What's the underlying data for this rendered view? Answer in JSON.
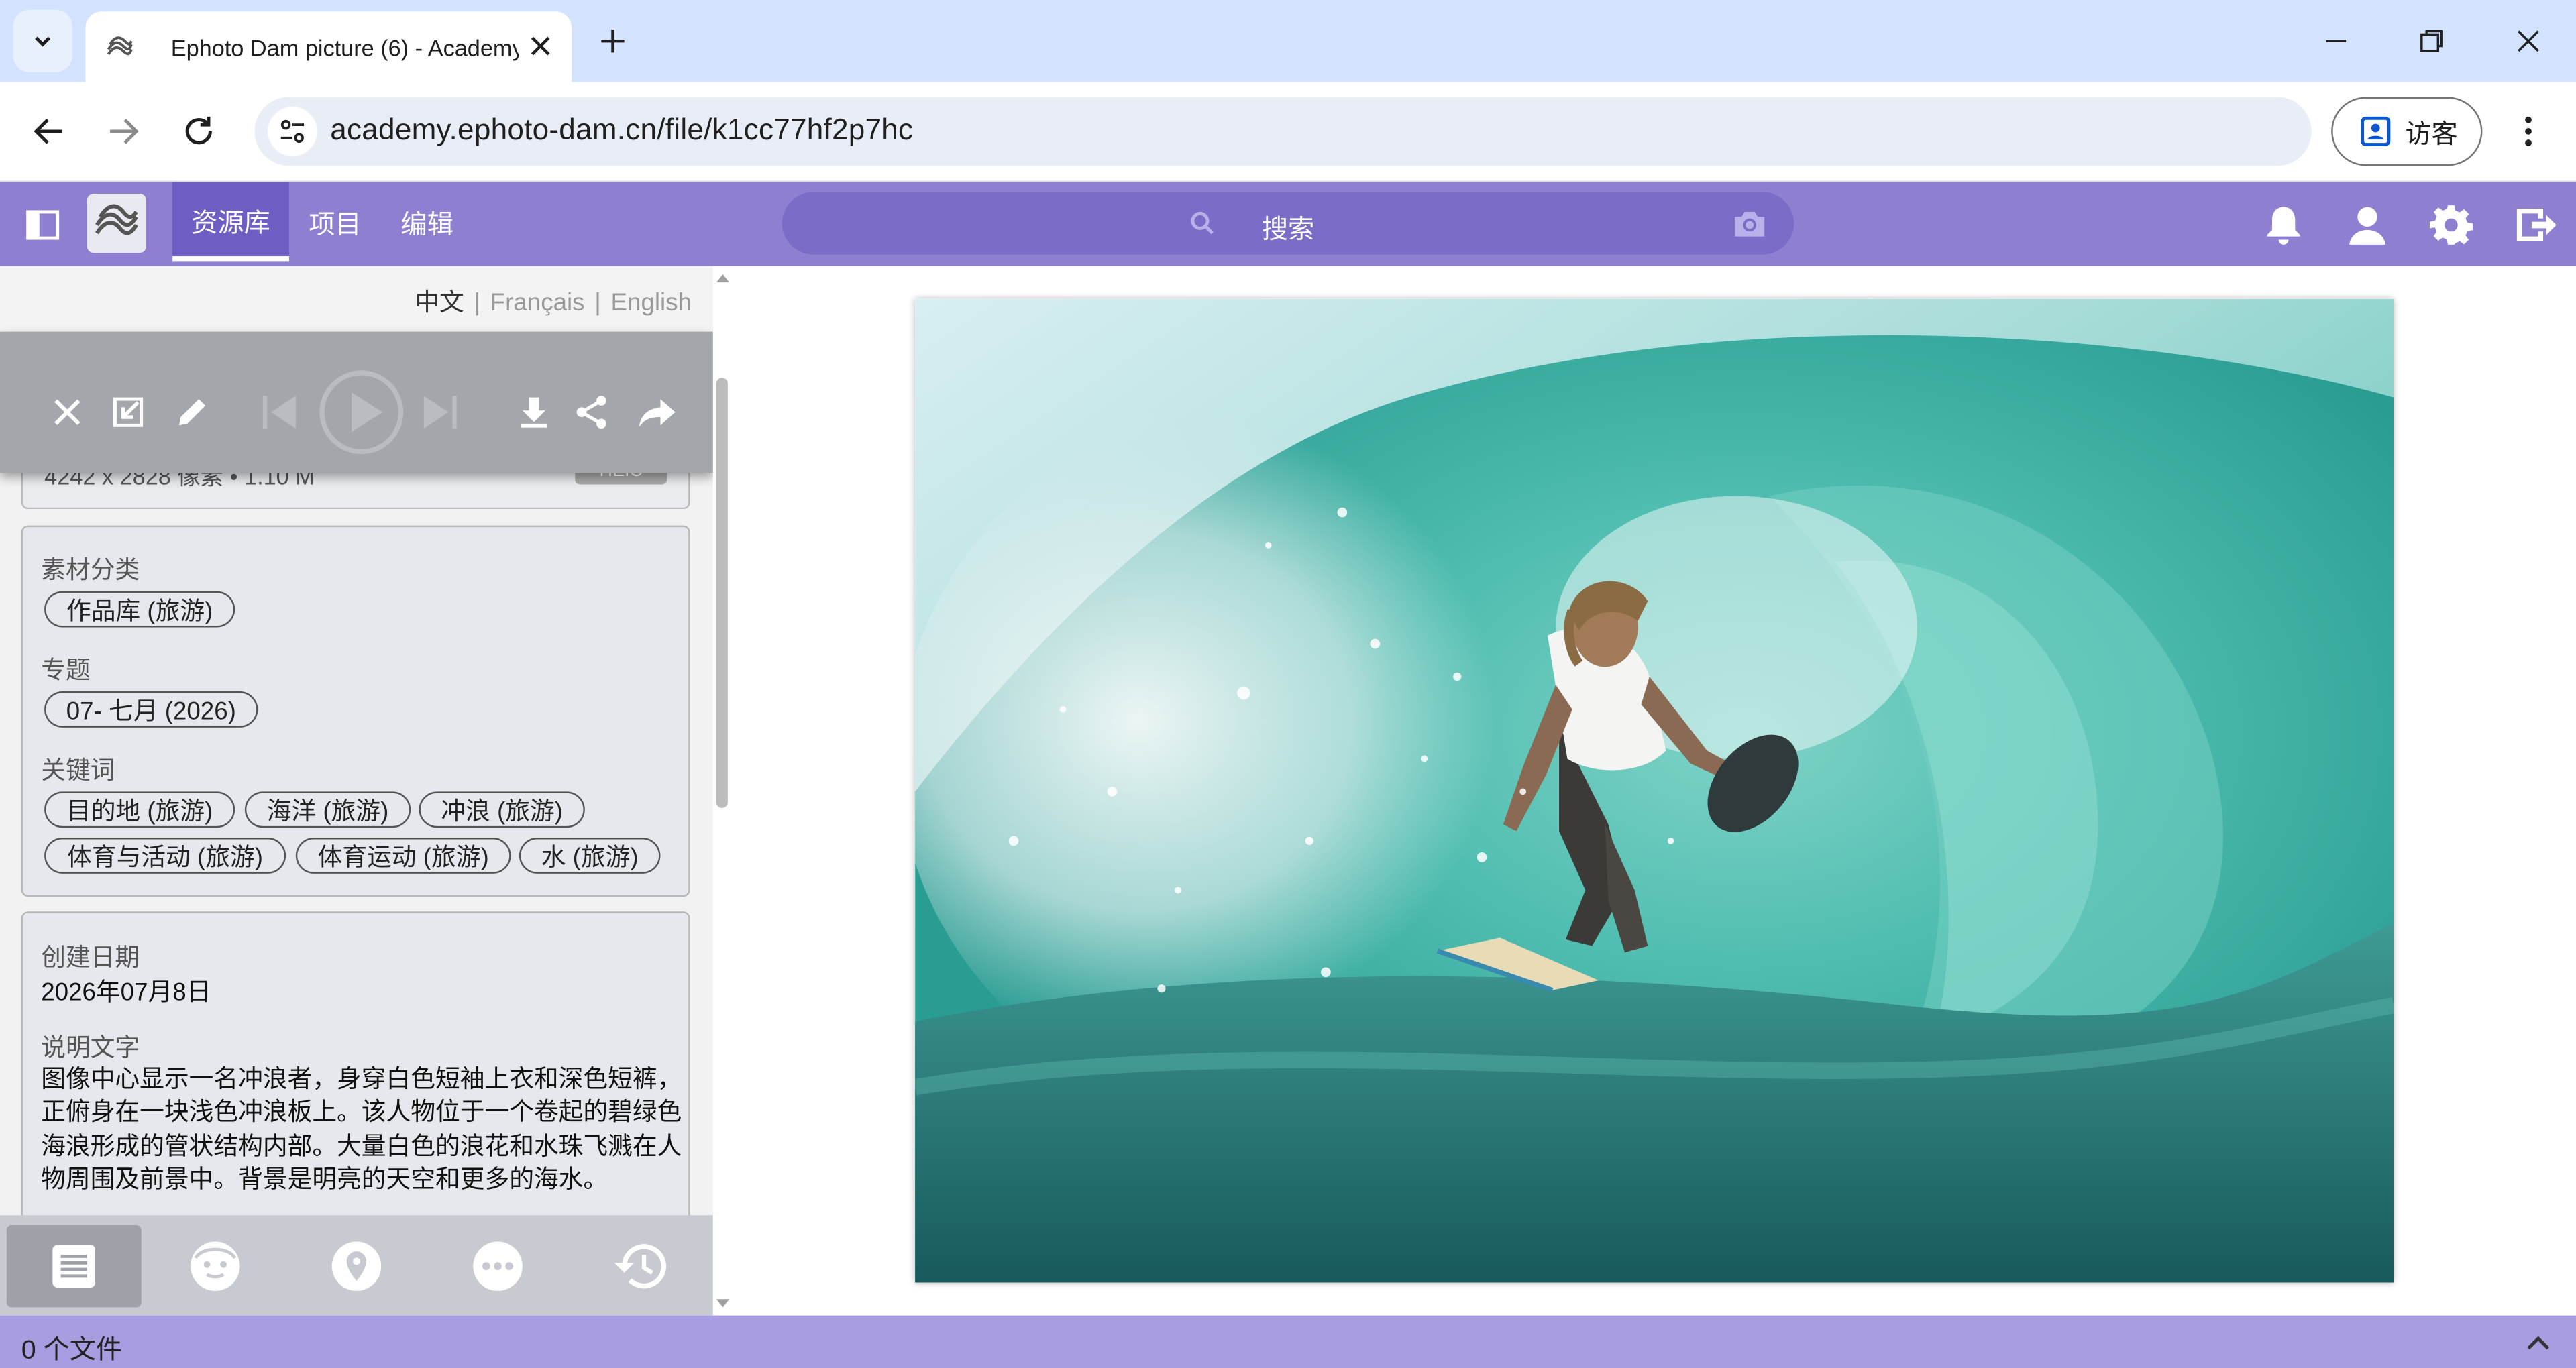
{
  "browser": {
    "tab_title": "Ephoto Dam picture (6) - Academy",
    "url": "academy.ephoto-dam.cn/file/k1cc77hf2p7hc",
    "profile_label": "访客"
  },
  "appbar": {
    "nav_tabs": [
      {
        "label": "资源库",
        "active": true
      },
      {
        "label": "项目",
        "active": false
      },
      {
        "label": "编辑",
        "active": false
      }
    ],
    "search_placeholder": "搜索",
    "accent_color": "#8e7fd1"
  },
  "panel": {
    "languages": {
      "active": "中文",
      "others": [
        "Français",
        "English"
      ]
    },
    "file_info": {
      "dimensions": "4242 x 2828 像素 • 1.10 M",
      "format": "HEIC"
    },
    "category": {
      "label": "素材分类",
      "chips": [
        "作品库 (旅游)"
      ]
    },
    "topic": {
      "label": "专题",
      "chips": [
        "07- 七月 (2026)"
      ]
    },
    "keywords": {
      "label": "关键词",
      "chips": [
        "目的地 (旅游)",
        "海洋 (旅游)",
        "冲浪 (旅游)",
        "体育与活动 (旅游)",
        "体育运动 (旅游)",
        "水 (旅游)"
      ]
    },
    "created": {
      "label": "创建日期",
      "value": "2026年07月8日"
    },
    "caption": {
      "label": "说明文字",
      "text": "图像中心显示一名冲浪者，身穿白色短袖上衣和深色短裤，正俯身在一块浅色冲浪板上。该人物位于一个卷起的碧绿色海浪形成的管状结构内部。大量白色的浪花和水珠飞溅在人物周围及前景中。背景是明亮的天空和更多的海水。"
    }
  },
  "statusbar": {
    "file_count": "0 个文件"
  },
  "icons": [
    "sidebar-toggle-icon",
    "logo-icon",
    "search-icon",
    "camera-icon",
    "bell-icon",
    "user-icon",
    "gear-icon",
    "logout-icon",
    "close-icon",
    "exit-fullscreen-icon",
    "edit-icon",
    "previous-icon",
    "play-icon",
    "next-icon",
    "download-icon",
    "share-icon",
    "forward-icon",
    "list-icon",
    "face-icon",
    "location-icon",
    "more-icon",
    "history-icon"
  ]
}
